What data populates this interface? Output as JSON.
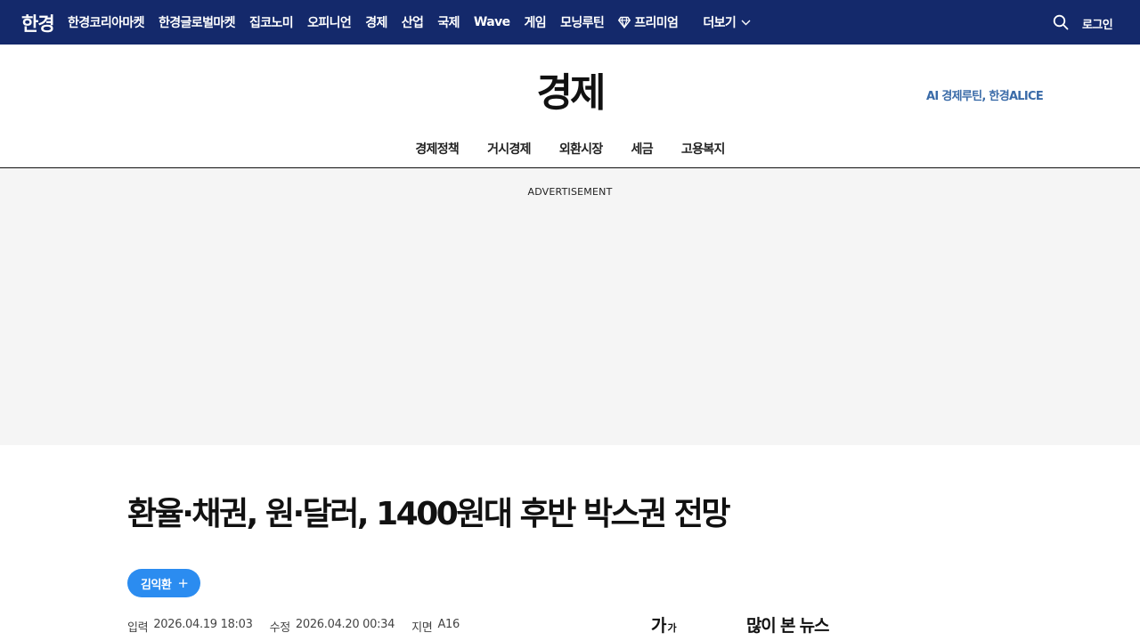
{
  "header": {
    "logo": "한경",
    "nav": [
      {
        "label": "한경코리아마켓"
      },
      {
        "label": "한경글로벌마켓"
      },
      {
        "label": "집코노미"
      },
      {
        "label": "오피니언"
      },
      {
        "label": "경제"
      },
      {
        "label": "산업"
      },
      {
        "label": "국제"
      },
      {
        "label": "Wave"
      },
      {
        "label": "게임"
      },
      {
        "label": "모닝루틴"
      },
      {
        "label": "프리미엄",
        "icon": "diamond-icon"
      }
    ],
    "more_label": "더보기",
    "login_label": "로그인",
    "bg_color": "#14296b"
  },
  "section": {
    "title": "경제",
    "ai_link": "AI 경제루틴, 한경ALICE",
    "subnav": [
      "경제정책",
      "거시경제",
      "외환시장",
      "세금",
      "고용복지"
    ]
  },
  "ad": {
    "label": "ADVERTISEMENT"
  },
  "article": {
    "headline": "환율·채권, 원·달러, 1400원대 후반 박스권 전망",
    "author": "김익환",
    "meta": {
      "input_label": "입력",
      "input_value": "2026.04.19 18:03",
      "edit_label": "수정",
      "edit_value": "2026.04.20 00:34",
      "page_label": "지면",
      "page_value": "A16"
    },
    "font_size_big": "가",
    "font_size_small": "가",
    "popular_title": "많이 본 뉴스",
    "author_color": "#2b8cf0"
  }
}
